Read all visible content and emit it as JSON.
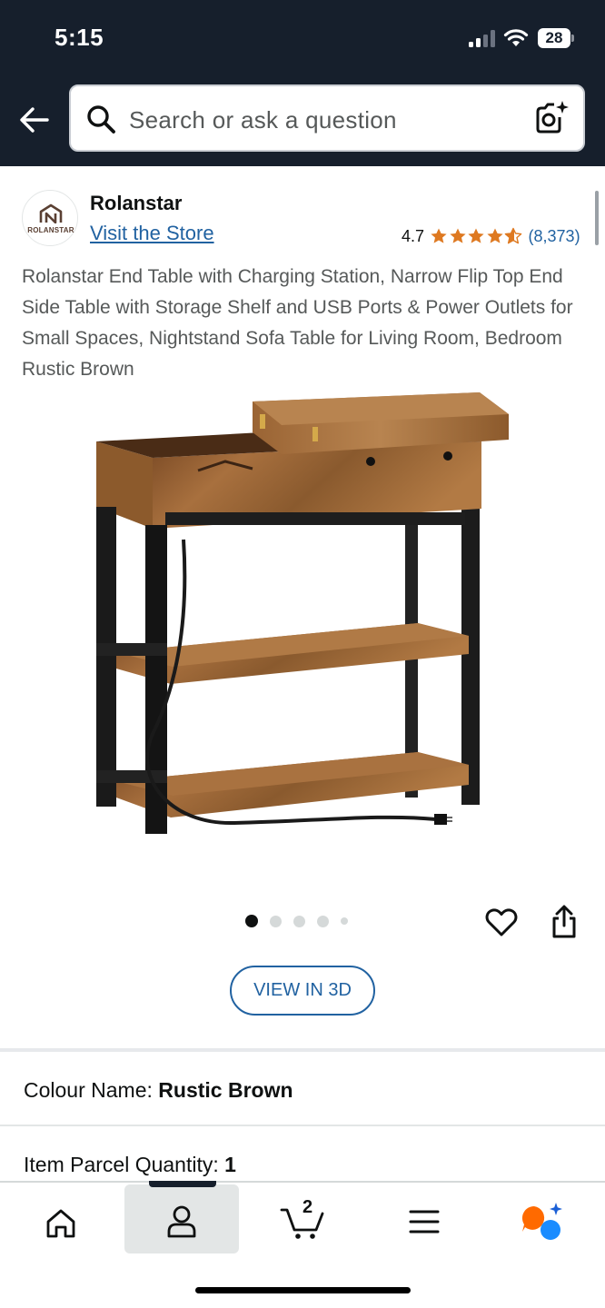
{
  "status_bar": {
    "time": "5:15",
    "battery": "28"
  },
  "header": {
    "search_placeholder": "Search or ask a question",
    "icons": [
      "back-arrow-icon",
      "search-icon",
      "camera-search-icon"
    ]
  },
  "brand": {
    "logo_text": "ROLANSTAR",
    "name": "Rolanstar",
    "store_link": "Visit the Store"
  },
  "rating": {
    "value": "4.7",
    "stars": 4.7,
    "count": "(8,373)"
  },
  "product": {
    "title": "Rolanstar End Table with Charging Station, Narrow Flip Top End Side Table with Storage Shelf and USB Ports & Power Outlets for Small Spaces, Nightstand Sofa Table for Living Room, Bedroom Rustic Brown",
    "image_count": 5,
    "active_image": 1,
    "view_3d_label": "VIEW IN 3D"
  },
  "attributes": [
    {
      "label": "Colour Name:",
      "value": "Rustic Brown"
    },
    {
      "label": "Item Parcel Quantity:",
      "value": "1"
    }
  ],
  "bottom_nav": {
    "cart_count": "2",
    "items": [
      "home-icon",
      "account-icon",
      "cart-icon",
      "menu-icon",
      "rufus-icon"
    ],
    "active": "account-icon"
  },
  "colors": {
    "header_bg": "#161f2c",
    "link": "#2162a1",
    "star": "#de7921",
    "text_secondary": "#565959"
  }
}
